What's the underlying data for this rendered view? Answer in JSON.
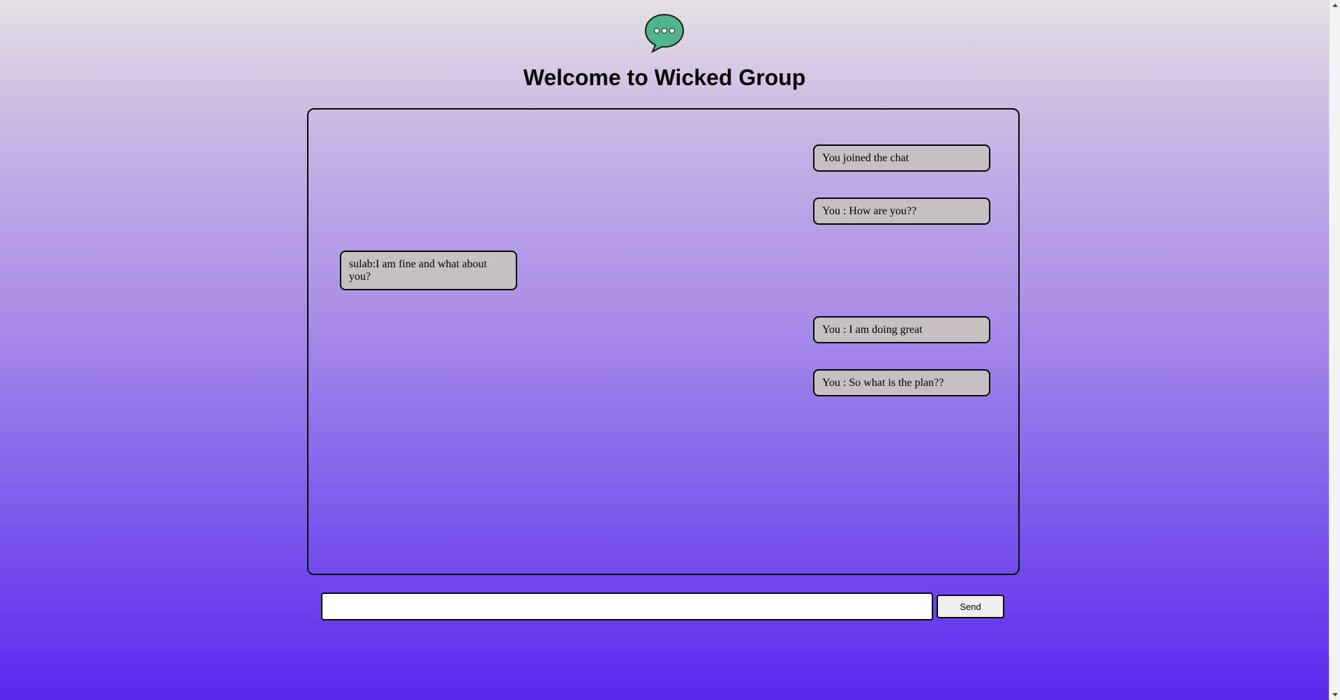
{
  "header": {
    "logo_icon": "chat-bubble-icon",
    "logo_color": "#4fb58a",
    "title": "Welcome to Wicked Group"
  },
  "messages": [
    {
      "side": "right",
      "text": "You joined the chat"
    },
    {
      "side": "right",
      "text": "You : How are you??"
    },
    {
      "side": "left",
      "text": "sulab:I am fine and what about you?"
    },
    {
      "side": "right",
      "text": "You : I am doing great"
    },
    {
      "side": "right",
      "text": "You : So what is the plan??"
    }
  ],
  "composer": {
    "input_value": "",
    "send_label": "Send"
  }
}
